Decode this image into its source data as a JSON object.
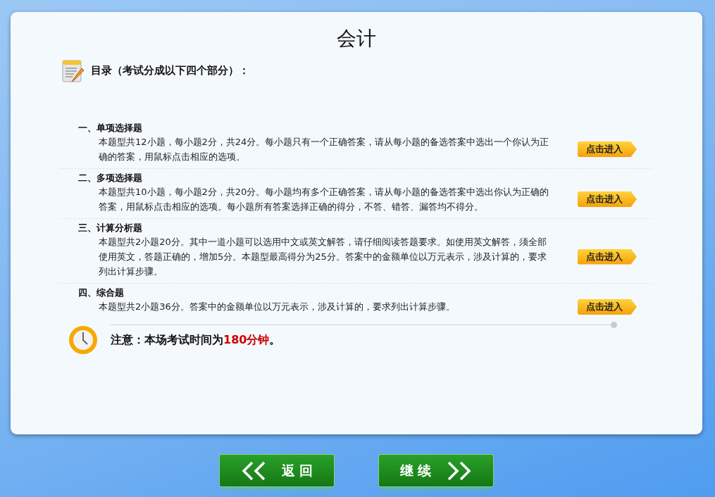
{
  "title": "会计",
  "toc_heading": "目录（考试分成以下四个部分）：",
  "sections": [
    {
      "title": "一、单项选择题",
      "description": "本题型共12小题，每小题2分，共24分。每小题只有一个正确答案，请从每小题的备选答案中选出一个你认为正确的答案，用鼠标点击相应的选项。",
      "button": "点击进入"
    },
    {
      "title": "二、多项选择题",
      "description": "本题型共10小题，每小题2分，共20分。每小题均有多个正确答案，请从每小题的备选答案中选出你认为正确的答案，用鼠标点击相应的选项。每小题所有答案选择正确的得分，不答、错答、漏答均不得分。",
      "button": "点击进入"
    },
    {
      "title": "三、计算分析题",
      "description": "本题型共2小题20分。其中一道小题可以选用中文或英文解答，请仔细阅读答题要求。如使用英文解答，须全部使用英文，答题正确的，增加5分。本题型最高得分为25分。答案中的金额单位以万元表示，涉及计算的，要求列出计算步骤。",
      "button": "点击进入"
    },
    {
      "title": "四、综合题",
      "description": "本题型共2小题36分。答案中的金额单位以万元表示，涉及计算的，要求列出计算步骤。",
      "button": "点击进入"
    }
  ],
  "note": {
    "text": "注意：本场考试时间为",
    "highlight": "180分钟",
    "end": "。"
  },
  "nav_buttons": [
    {
      "kind": "back",
      "label": "返 回"
    },
    {
      "kind": "next",
      "label": "继 续"
    }
  ]
}
